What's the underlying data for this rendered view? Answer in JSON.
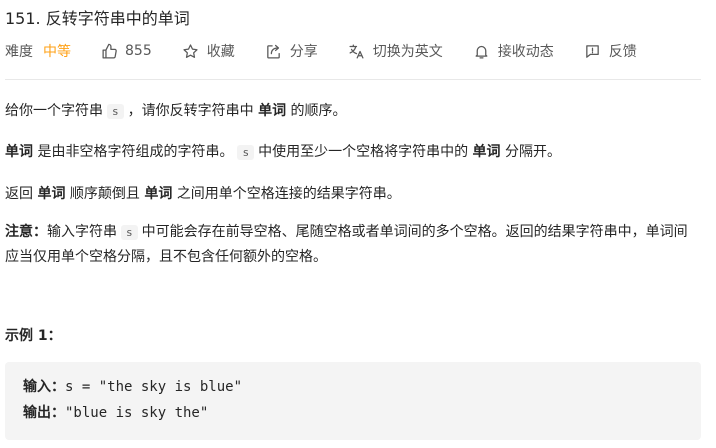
{
  "problem": {
    "title": "151. 反转字符串中的单词"
  },
  "meta": {
    "difficulty_label": "难度",
    "difficulty_value": "中等",
    "likes": "855",
    "favorite": "收藏",
    "share": "分享",
    "translate": "切换为英文",
    "notify": "接收动态",
    "feedback": "反馈"
  },
  "colors": {
    "difficulty": "#ffa116",
    "text": "#262626",
    "muted": "#595959"
  },
  "description": {
    "p1": {
      "a": "给你一个字符串",
      "code": "s",
      "b": "，请你反转字符串中",
      "bold": "单词",
      "c": "的顺序。"
    },
    "p2": {
      "bold1": "单词",
      "a": "是由非空格字符组成的字符串。",
      "code": "s",
      "b": "中使用至少一个空格将字符串中的",
      "bold2": "单词",
      "c": "分隔开。"
    },
    "p3": {
      "a": "返回",
      "bold1": "单词",
      "b": "顺序颠倒且",
      "bold2": "单词",
      "c": "之间用单个空格连接的结果字符串。"
    },
    "p4": {
      "bold": "注意：",
      "a": "输入字符串",
      "code": "s",
      "b": "中可能会存在前导空格、尾随空格或者单词间的多个空格。返回的结果字符串中，单词间应当仅用单个空格分隔，且不包含任何额外的空格。"
    }
  },
  "example": {
    "title": "示例 1：",
    "input_label": "输入：",
    "input_value": "s = \"the sky is blue\"",
    "output_label": "输出：",
    "output_value": "\"blue is sky the\""
  }
}
